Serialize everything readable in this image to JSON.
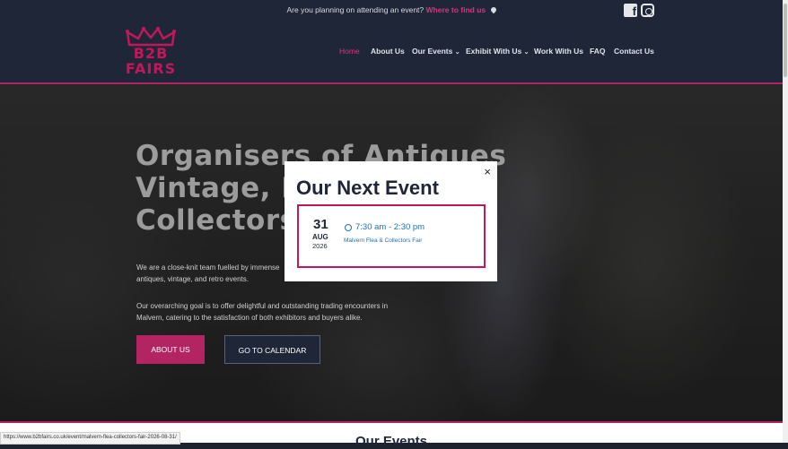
{
  "topbar": {
    "message": "Are you planning on attending an event?",
    "link": "Where to find us",
    "icons": [
      "map-pin-icon",
      "facebook-icon",
      "instagram-icon"
    ]
  },
  "logo": {
    "line1": "B2B",
    "line2": "FAIRS"
  },
  "nav": {
    "home": "Home",
    "about": "About Us",
    "events": "Our Events",
    "exhibit": "Exhibit With Us",
    "work": "Work With Us",
    "faq": "FAQ",
    "contact": "Contact Us"
  },
  "hero": {
    "heading_line1": "Organisers of Antiques",
    "heading_line2": "Vintage, Fle",
    "heading_line3": "Collectors E",
    "para1_line1": "We are a close-knit team fuelled by immense",
    "para1_line2": "antiques, vintage, and retro events.",
    "para2_line1": "Our overarching goal is to offer delightful and outstanding trading encounters in",
    "para2_line2": "Malvern, catering to the satisfaction of both exhibitors and buyers alike.",
    "btn_about": "ABOUT US",
    "btn_calendar": "GO TO CALENDAR"
  },
  "modal": {
    "title": "Our Next Event",
    "close": "×",
    "day": "31",
    "month": "AUG",
    "year": "2026",
    "time": "7:30 am - 2:30 pm",
    "event_name": "Malvern Flea & Collectors Fair"
  },
  "section": {
    "title": "Our Events"
  },
  "statusbar": {
    "url": "https://www.b2bfairs.co.uk/event/malvern-flea-collectors-fair-2026-08-31/"
  },
  "colors": {
    "navy": "#1f2637",
    "accent": "#c2185b",
    "link_blue": "#1f6fb5"
  }
}
